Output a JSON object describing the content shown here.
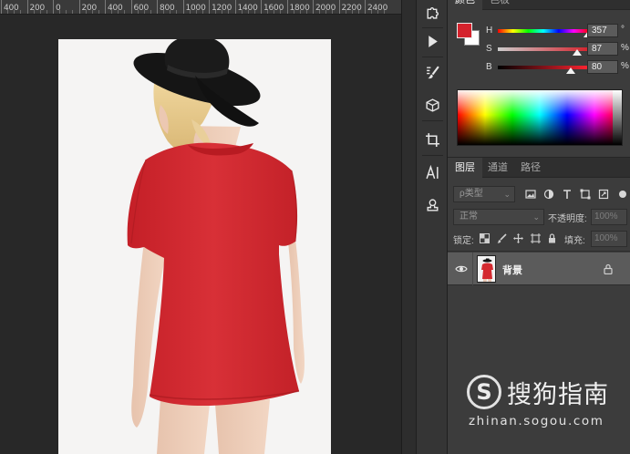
{
  "ruler": {
    "ticks": [
      "400",
      "200",
      "0",
      "200",
      "400",
      "600",
      "800",
      "1000",
      "1200",
      "1400",
      "1600",
      "1800",
      "2000",
      "2200",
      "2400"
    ]
  },
  "color_panel": {
    "tabs": [
      "颜色",
      "色板"
    ],
    "foreground_color": "#d4222c",
    "background_color": "#ffffff",
    "h": {
      "label": "H",
      "value": "357",
      "unit": "°",
      "level": 0.99
    },
    "s": {
      "label": "S",
      "value": "87",
      "unit": "%",
      "level": 0.87
    },
    "b": {
      "label": "B",
      "value": "80",
      "unit": "%",
      "level": 0.8
    }
  },
  "layers_panel": {
    "tabs": [
      "图层",
      "通道",
      "路径"
    ],
    "kind_filter": "ρ类型",
    "blend_mode": "正常",
    "opacity_label": "不透明度:",
    "opacity_value": "100%",
    "lock_label": "锁定:",
    "fill_label": "填充:",
    "fill_value": "100%",
    "layer": {
      "name": "背景",
      "visible": true,
      "locked": true
    }
  },
  "watermark": {
    "brand": "搜狗指南",
    "url": "zhinan.sogou.com"
  },
  "colors": {
    "shirt": "#d42a30",
    "canvas_bg": "#282828",
    "panel_bg": "#3c3c3c"
  }
}
